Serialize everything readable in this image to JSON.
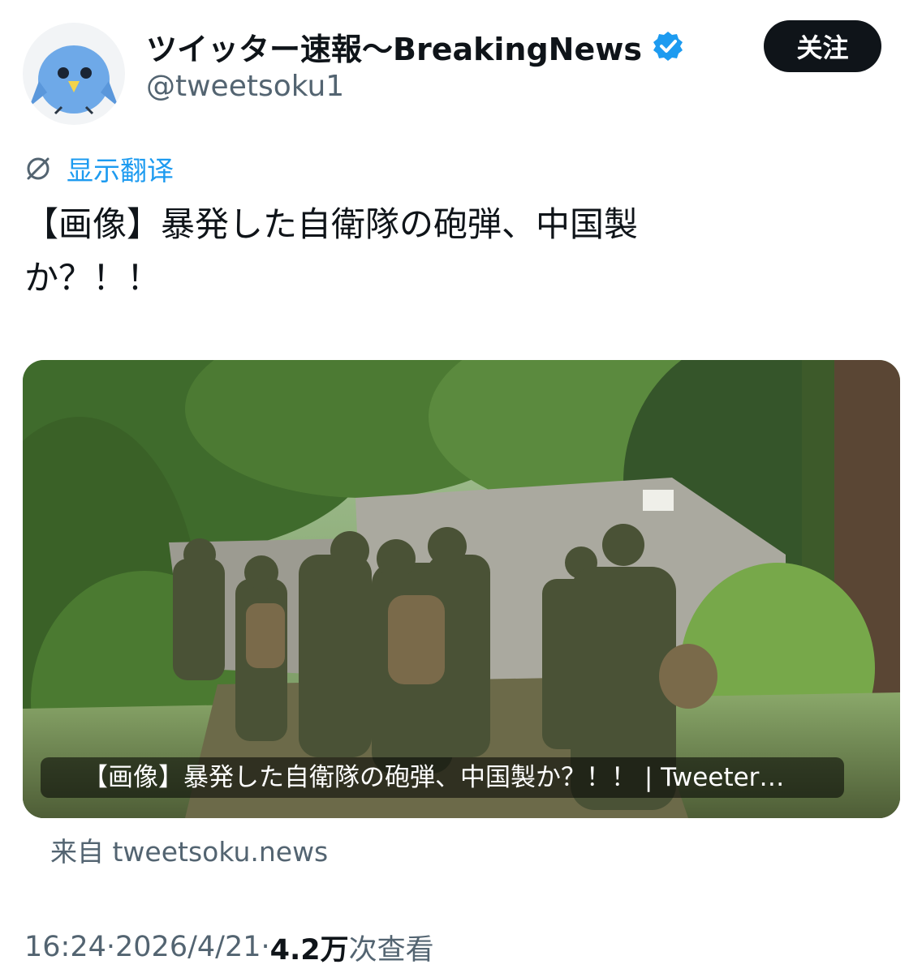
{
  "author": {
    "display_name": "ツイッター速報〜BreakingNews",
    "handle": "@tweetsoku1",
    "verified_icon": "verified-badge-icon",
    "avatar_icon": "blue-bird-icon"
  },
  "actions": {
    "follow_label": "关注"
  },
  "translate": {
    "icon": "translate-globe-icon",
    "label": "显示翻译"
  },
  "tweet": {
    "text_line1": "【画像】暴発した自衛隊の砲弾、中国製",
    "text_line2": "か？！！"
  },
  "card": {
    "caption": "【画像】暴発した自衛隊の砲弾、中国製か？！！ | Tweeter…",
    "source": "来自 tweetsoku.news"
  },
  "meta": {
    "time": "16:24",
    "separator": " · ",
    "date": "2026/4/21",
    "views_count": "4.2万",
    "views_label": " 次查看"
  },
  "colors": {
    "accent": "#1d9bf0",
    "text_primary": "#0f1419",
    "text_secondary": "#536471",
    "button_bg": "#0f1419"
  }
}
